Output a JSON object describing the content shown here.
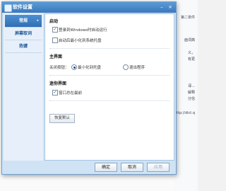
{
  "background": {
    "lines": [
      "第二单件",
      "面词典",
      "义，",
      "有更",
      "译...",
      "解释",
      "分信",
      "http://dict.q"
    ]
  },
  "dialog": {
    "title": "软件设置",
    "minimize_glyph": "–",
    "close_glyph": "×"
  },
  "sidebar": {
    "items": [
      {
        "label": "常规",
        "active": true
      },
      {
        "label": "屏幕取词",
        "active": false
      },
      {
        "label": "热键",
        "active": false
      }
    ]
  },
  "sections": {
    "startup": {
      "title": "启动",
      "options": [
        {
          "label": "登录到Windows时自动运行",
          "checked": true
        },
        {
          "label": "启动后最小化到系统托盘",
          "checked": false
        }
      ]
    },
    "main": {
      "title": "主界面",
      "close_label": "关闭按钮：",
      "options": [
        {
          "label": "最小化到托盘",
          "selected": true
        },
        {
          "label": "退出程序",
          "selected": false
        }
      ]
    },
    "mini": {
      "title": "迷你界面",
      "options": [
        {
          "label": "窗口总在最前",
          "checked": true
        }
      ]
    }
  },
  "buttons": {
    "restore": "恢复默认",
    "ok": "确定",
    "cancel": "取消",
    "apply": "应用"
  },
  "check_glyph": "✓",
  "colors": {
    "titlebar": "#3a78bb",
    "sidebar_active": "#2e6fb3",
    "panel_bg": "#cfe3f4"
  }
}
